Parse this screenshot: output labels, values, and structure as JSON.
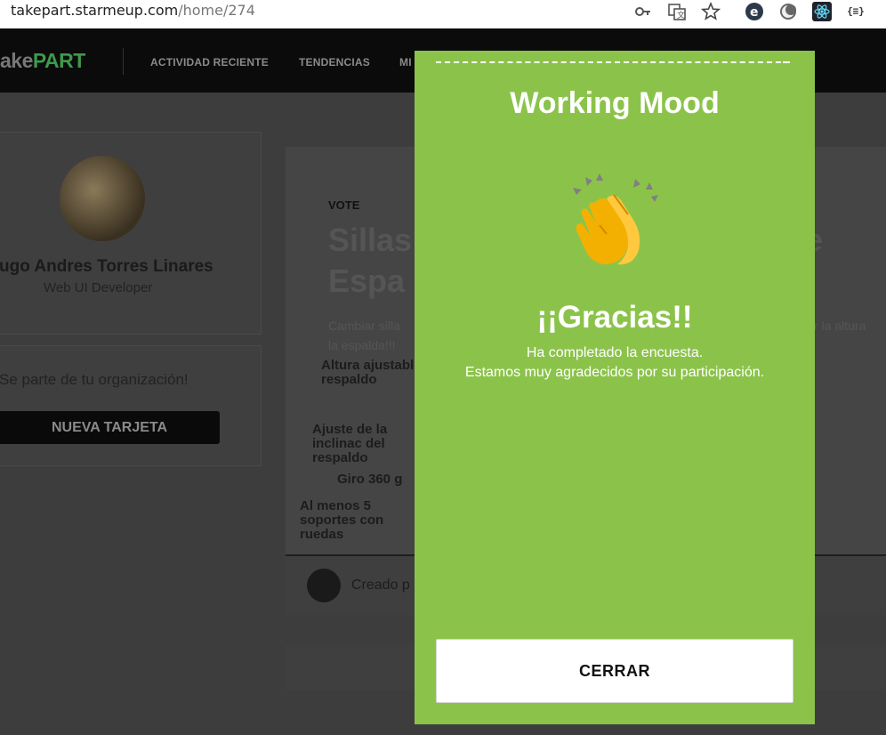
{
  "browser": {
    "url_host": "takepart.starmeup.com",
    "url_path": "/home/274",
    "icons": [
      "key-icon",
      "translate-icon",
      "star-icon",
      "extension-e-icon",
      "extension-moon-icon",
      "extension-react-icon",
      "extension-json-icon"
    ]
  },
  "nav": {
    "logo_prefix": "ake",
    "logo_accent": "PART",
    "links": [
      "ACTIVIDAD RECIENTE",
      "TENDENCIAS",
      "MI"
    ]
  },
  "profile": {
    "name": "ugo Andres Torres Linares",
    "role": "Web UI Developer",
    "org_text": "Se parte de tu organización!",
    "new_card_label": "NUEVA TARJETA"
  },
  "post": {
    "tag": "VOTE",
    "title_line1": "Sillas",
    "title_line1_tail": "le",
    "title_line2": "Espa",
    "desc_line1": "Cambiar silla",
    "desc_tail": "r la altura",
    "desc_line2": "la espalda!!!",
    "labels": [
      "Altura ajustable del respaldo",
      "Ajuste de la inclinac del respaldo",
      "Giro 360 g",
      "Al menos 5 soportes con ruedas"
    ],
    "footer_created": "Creado p"
  },
  "modal": {
    "title": "Working Mood",
    "icon": "clapping-hands-icon",
    "thanks": "¡¡Gracias!!",
    "line1": "Ha completado la encuesta.",
    "line2": "Estamos muy agradecidos por su participación.",
    "close_label": "CERRAR"
  },
  "colors": {
    "modal_bg": "#8bc34a",
    "logo_accent": "#3d9a4c"
  }
}
